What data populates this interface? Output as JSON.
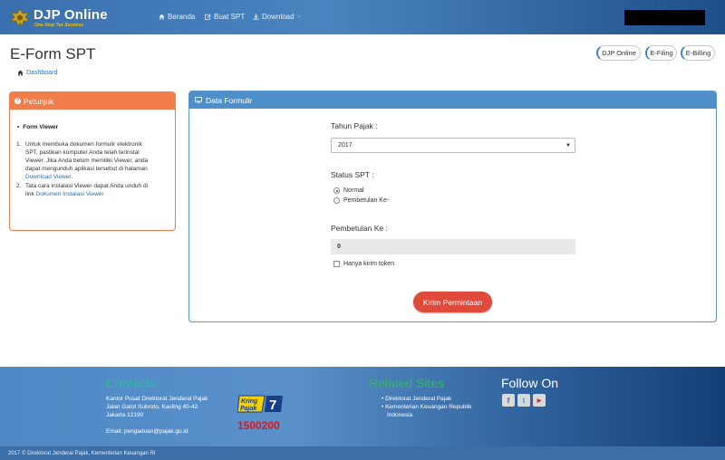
{
  "navbar": {
    "brand_title": "DJP Online",
    "brand_tagline": "One Stop Tax Services",
    "items": [
      {
        "label": "Beranda",
        "icon": "home-icon"
      },
      {
        "label": "Buat SPT",
        "icon": "edit-icon"
      },
      {
        "label": "Download",
        "icon": "download-icon"
      }
    ]
  },
  "page": {
    "title": "E-Form SPT",
    "breadcrumb": "Dashboard",
    "pills": [
      "DJP Online",
      "E-Filing",
      "E-Billing"
    ]
  },
  "petunjuk": {
    "title": "Petunjuk",
    "section_title": "Form Viewer",
    "items": [
      {
        "text": "Untuk membuka dokumen formulir elektronik SPT, pastikan komputer Anda telah terinstal Viewer. Jika Anda belum memiliki Viewer, anda dapat mengunduh aplikasi tersebut di halaman ",
        "link": "Download Viewer",
        "after": "."
      },
      {
        "text": "Tata cara instalasi Viewer dapat Anda unduh di link ",
        "link": "Dokumen Instalasi Viewer",
        "after": ""
      }
    ]
  },
  "form": {
    "panel_title": "Data Formulir",
    "tahun_label": "Tahun Pajak :",
    "tahun_value": "2017",
    "status_label": "Status SPT :",
    "status_options": [
      "Normal",
      "Pembetulan Ke-"
    ],
    "status_selected": "Normal",
    "pembetulan_label": "Pembetulan Ke :",
    "pembetulan_value": "0",
    "token_label": "Hanya kirim token",
    "submit_label": "Kirim Permintaan"
  },
  "footer": {
    "contacts_title": "Contacts",
    "address_lines": [
      "Kantor Pusat Direktorat Jenderal Pajak",
      "Jalan Gatot Subroto, Kavling 40-42",
      "Jakarta 12190"
    ],
    "email_label": "Email:",
    "email": "pengaduan@pajak.go.id",
    "kring_pajak_line1": "Kring",
    "kring_pajak_line2": "Pajak",
    "kring_pajak_number": "1500200",
    "related_title": "Related Sites",
    "related_links": [
      "Direktorat Jenderal Pajak",
      "Kementerian Keuangan Republik",
      "Indonesia"
    ],
    "follow_title": "Follow On",
    "social": [
      "facebook-icon",
      "twitter-icon",
      "youtube-icon"
    ],
    "copyright": "2017 © Direktorat Jenderal Pajak, Kementerian Keuangan RI"
  },
  "colors": {
    "accent_orange": "#f27d4c",
    "accent_blue": "#4f8fc9",
    "submit_red": "#e04a3a",
    "contacts_heading": "#2fb8a8",
    "related_heading": "#2fb85a",
    "follow_heading": "#ffffff"
  }
}
